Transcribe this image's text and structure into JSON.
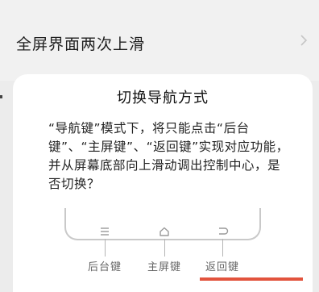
{
  "settings": {
    "row_label": "全屏界面两次上滑"
  },
  "dialog": {
    "title": "切换导航方式",
    "message": "“导航键”模式下，将只能点击“后台键”、“主屏键”、“返回键”实现对应功能，并从屏幕底部向上滑动调出控制中心，是否切换？",
    "nav_labels": {
      "recents": "后台键",
      "home": "主屏键",
      "back": "返回键"
    }
  },
  "colors": {
    "accent": "#e2533d"
  },
  "icons": {
    "row": "chevron-right-icon",
    "recents": "menu-lines-icon",
    "home": "home-icon",
    "back": "back-arrow-icon"
  }
}
